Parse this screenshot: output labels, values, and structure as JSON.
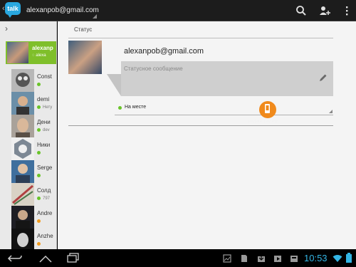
{
  "app": {
    "logo_text": "talk",
    "account": "alexanpob@gmail.com"
  },
  "actionbar": {
    "icons": [
      "search-icon",
      "add-friend-icon",
      "overflow-menu-icon"
    ]
  },
  "sidebar": {
    "me": {
      "name": "alexanp",
      "status": "alexa"
    },
    "contacts": [
      {
        "name": "Const",
        "status": "",
        "dot": "#6ac42a",
        "avatar": "avatar-const"
      },
      {
        "name": "demi",
        "status": "Нету",
        "dot": "#6ac42a",
        "avatar": "avatar-demi"
      },
      {
        "name": "Дени",
        "status": "dev",
        "dot": "#6ac42a",
        "avatar": "avatar-deni"
      },
      {
        "name": "Ники",
        "status": "",
        "dot": "#6ac42a",
        "avatar": "avatar-niki"
      },
      {
        "name": "Serge",
        "status": "",
        "dot": "#6ac42a",
        "avatar": "avatar-serge"
      },
      {
        "name": "Солд",
        "status": "797",
        "dot": "#6ac42a",
        "avatar": "avatar-sold"
      },
      {
        "name": "Andre",
        "status": "",
        "dot": "#f29c1f",
        "avatar": "avatar-andre"
      },
      {
        "name": "Anzhe",
        "status": "",
        "dot": "#f29c1f",
        "avatar": "avatar-anzhe"
      }
    ]
  },
  "main": {
    "section_title": "Статус",
    "email": "alexanpob@gmail.com",
    "status_message_placeholder": "Статусное сообщение",
    "presence": {
      "label": "На месте",
      "color": "#6ac42a"
    },
    "watermark": "mobile-review"
  },
  "system_bar": {
    "time": "10:53"
  },
  "colors": {
    "accent_green": "#7fbf2a",
    "clock_blue": "#33b5e5",
    "talk_blue": "#29a8e0"
  }
}
